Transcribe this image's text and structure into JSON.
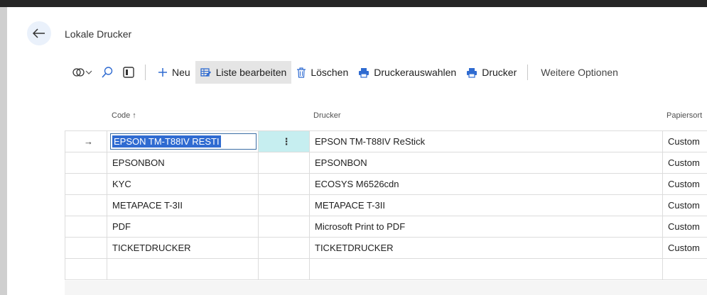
{
  "page": {
    "title": "Lokale Drucker"
  },
  "toolbar": {
    "new_label": "Neu",
    "edit_list_label": "Liste bearbeiten",
    "delete_label": "Löschen",
    "select_printer_label": "Druckerauswahlen",
    "printer_label": "Drucker",
    "more_options_label": "Weitere Optionen"
  },
  "table": {
    "columns": {
      "code": "Code",
      "sort_indicator": "↑",
      "printer": "Drucker",
      "paper": "Papiersort"
    },
    "row_marker": "→",
    "row_menu": "⋮",
    "rows": [
      {
        "code": "EPSON TM-T88IV RESTI",
        "printer": "EPSON TM-T88IV ReStick",
        "paper": "Custom"
      },
      {
        "code": "EPSONBON",
        "printer": "EPSONBON",
        "paper": "Custom"
      },
      {
        "code": "KYC",
        "printer": "ECOSYS M6526cdn",
        "paper": "Custom"
      },
      {
        "code": "METAPACE T-3II",
        "printer": "METAPACE T-3II",
        "paper": "Custom"
      },
      {
        "code": "PDF",
        "printer": "Microsoft Print to PDF",
        "paper": "Custom"
      },
      {
        "code": "TICKETDRUCKER",
        "printer": "TICKETDRUCKER",
        "paper": "Custom"
      }
    ]
  },
  "colors": {
    "accent": "#2f6bd1",
    "selection": "#2f6bd1",
    "row_menu_bg": "#c6eef0",
    "toolbar_active": "#e5e5e5"
  },
  "icons": [
    "back-arrow-icon",
    "filter-icon",
    "search-icon",
    "layout-icon",
    "plus-icon",
    "edit-list-icon",
    "trash-icon",
    "printer-icon"
  ]
}
